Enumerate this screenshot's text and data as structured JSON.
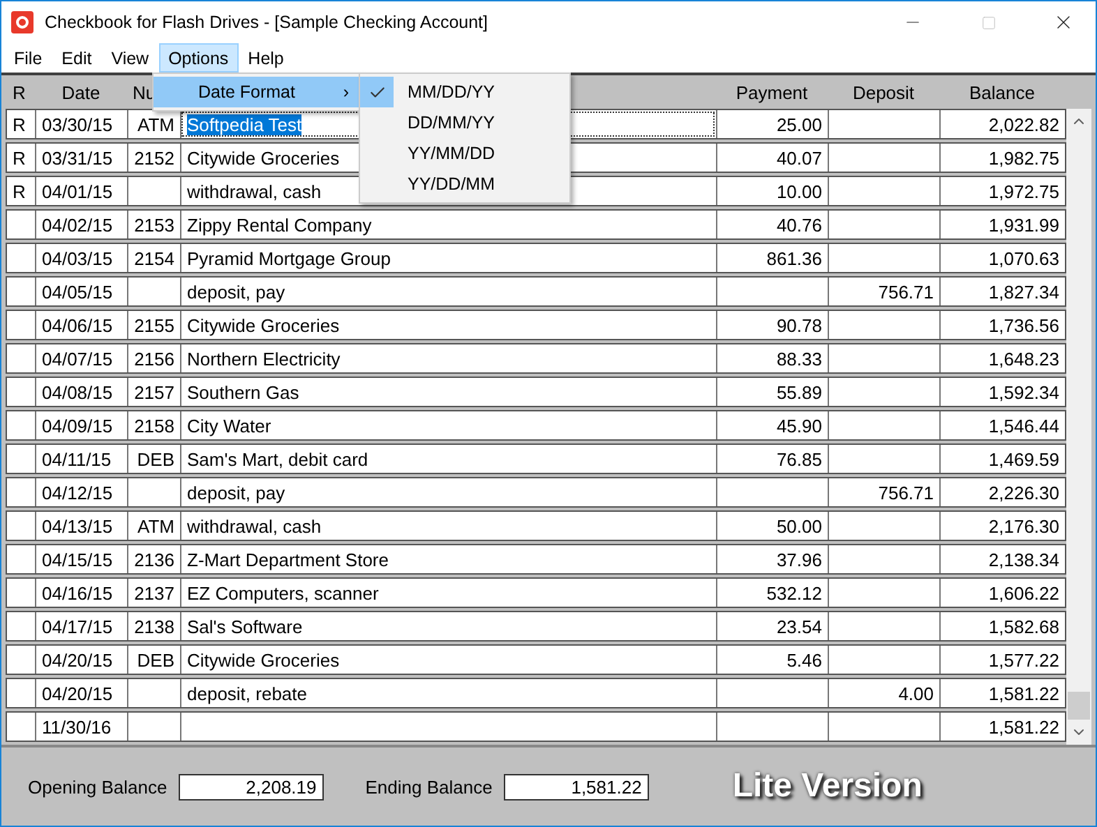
{
  "window": {
    "title": "Checkbook for Flash Drives - [Sample Checking Account]"
  },
  "menu_bar": [
    {
      "label": "File",
      "open": false
    },
    {
      "label": "Edit",
      "open": false
    },
    {
      "label": "View",
      "open": false
    },
    {
      "label": "Options",
      "open": true
    },
    {
      "label": "Help",
      "open": false
    }
  ],
  "options_menu": {
    "items": [
      {
        "label": "Date Format",
        "selected": true,
        "arrow": "›"
      }
    ],
    "submenu": [
      {
        "label": "MM/DD/YY",
        "checked": true
      },
      {
        "label": "DD/MM/YY",
        "checked": false
      },
      {
        "label": "YY/MM/DD",
        "checked": false
      },
      {
        "label": "YY/DD/MM",
        "checked": false
      }
    ]
  },
  "table": {
    "columns": [
      "R",
      "Date",
      "Nu",
      "Payment",
      "Deposit",
      "Balance"
    ],
    "rows": [
      {
        "r": "R",
        "date": "03/30/15",
        "num": "ATM",
        "description": "Softpedia Test",
        "payment": "25.00",
        "deposit": "",
        "balance": "2,022.82",
        "selected": true
      },
      {
        "r": "R",
        "date": "03/31/15",
        "num": "2152",
        "description": "Citywide Groceries",
        "payment": "40.07",
        "deposit": "",
        "balance": "1,982.75",
        "selected": false
      },
      {
        "r": "R",
        "date": "04/01/15",
        "num": "",
        "description": "withdrawal, cash",
        "payment": "10.00",
        "deposit": "",
        "balance": "1,972.75",
        "selected": false
      },
      {
        "r": "",
        "date": "04/02/15",
        "num": "2153",
        "description": "Zippy Rental Company",
        "payment": "40.76",
        "deposit": "",
        "balance": "1,931.99",
        "selected": false
      },
      {
        "r": "",
        "date": "04/03/15",
        "num": "2154",
        "description": "Pyramid Mortgage Group",
        "payment": "861.36",
        "deposit": "",
        "balance": "1,070.63",
        "selected": false
      },
      {
        "r": "",
        "date": "04/05/15",
        "num": "",
        "description": "deposit, pay",
        "payment": "",
        "deposit": "756.71",
        "balance": "1,827.34",
        "selected": false
      },
      {
        "r": "",
        "date": "04/06/15",
        "num": "2155",
        "description": "Citywide Groceries",
        "payment": "90.78",
        "deposit": "",
        "balance": "1,736.56",
        "selected": false
      },
      {
        "r": "",
        "date": "04/07/15",
        "num": "2156",
        "description": "Northern Electricity",
        "payment": "88.33",
        "deposit": "",
        "balance": "1,648.23",
        "selected": false
      },
      {
        "r": "",
        "date": "04/08/15",
        "num": "2157",
        "description": "Southern Gas",
        "payment": "55.89",
        "deposit": "",
        "balance": "1,592.34",
        "selected": false
      },
      {
        "r": "",
        "date": "04/09/15",
        "num": "2158",
        "description": "City Water",
        "payment": "45.90",
        "deposit": "",
        "balance": "1,546.44",
        "selected": false
      },
      {
        "r": "",
        "date": "04/11/15",
        "num": "DEB",
        "description": "Sam's Mart, debit card",
        "payment": "76.85",
        "deposit": "",
        "balance": "1,469.59",
        "selected": false
      },
      {
        "r": "",
        "date": "04/12/15",
        "num": "",
        "description": "deposit, pay",
        "payment": "",
        "deposit": "756.71",
        "balance": "2,226.30",
        "selected": false
      },
      {
        "r": "",
        "date": "04/13/15",
        "num": "ATM",
        "description": "withdrawal, cash",
        "payment": "50.00",
        "deposit": "",
        "balance": "2,176.30",
        "selected": false
      },
      {
        "r": "",
        "date": "04/15/15",
        "num": "2136",
        "description": "Z-Mart Department Store",
        "payment": "37.96",
        "deposit": "",
        "balance": "2,138.34",
        "selected": false
      },
      {
        "r": "",
        "date": "04/16/15",
        "num": "2137",
        "description": "EZ Computers, scanner",
        "payment": "532.12",
        "deposit": "",
        "balance": "1,606.22",
        "selected": false
      },
      {
        "r": "",
        "date": "04/17/15",
        "num": "2138",
        "description": "Sal's Software",
        "payment": "23.54",
        "deposit": "",
        "balance": "1,582.68",
        "selected": false
      },
      {
        "r": "",
        "date": "04/20/15",
        "num": "DEB",
        "description": "Citywide Groceries",
        "payment": "5.46",
        "deposit": "",
        "balance": "1,577.22",
        "selected": false
      },
      {
        "r": "",
        "date": "04/20/15",
        "num": "",
        "description": "deposit, rebate",
        "payment": "",
        "deposit": "4.00",
        "balance": "1,581.22",
        "selected": false
      },
      {
        "r": "",
        "date": "11/30/16",
        "num": "",
        "description": "",
        "payment": "",
        "deposit": "",
        "balance": "1,581.22",
        "selected": false
      }
    ]
  },
  "footer": {
    "opening_label": "Opening Balance",
    "opening_value": "2,208.19",
    "ending_label": "Ending Balance",
    "ending_value": "1,581.22",
    "edition": "Lite Version"
  }
}
